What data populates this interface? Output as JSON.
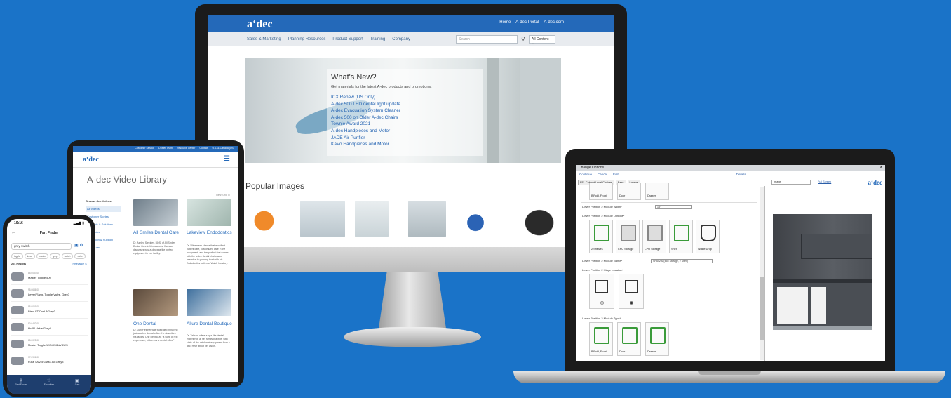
{
  "desktop": {
    "logo": "a‘dec",
    "top_links": [
      "Home",
      "A-dec Portal",
      "A-dec.com"
    ],
    "nav": [
      "Sales & Marketing",
      "Planning Resources",
      "Product Support",
      "Training",
      "Company"
    ],
    "search_placeholder": "Search",
    "search_scope": "All Content ⌄",
    "hero": {
      "title": "What's New?",
      "subtitle": "Get materials for the latest A-dec products and promotions.",
      "links": [
        "ICX Renew (US Only)",
        "A-dec 500 LED dental light update",
        "A-dec Evacuation System Cleaner",
        "A-dec 500 on Older A-dec Chairs",
        "Townie Award 2021",
        "A-dec Handpieces and Motor",
        "JADE Air Purifier",
        "KaVo Handpieces and Motor"
      ]
    },
    "popular_title": "Popular Images"
  },
  "tablet": {
    "top_links": [
      "Customer Service",
      "Dealer Team",
      "Resource Center",
      "Contact",
      "U.S. & Canada (US)"
    ],
    "logo": "a‘dec",
    "title": "A-dec Video Library",
    "view": "View: Grid ☰",
    "sidebar_heading": "Browse dec Videos",
    "sidebar": [
      "All Videos",
      "Customer Stories",
      "Products & Solutions",
      "Built a dec",
      "Education & Support",
      "Why a-dec"
    ],
    "cards": [
      {
        "title": "All Smiles Dental Care",
        "text": "Dr. Ashley Steckley, DDS, of All Smiles Dental Care in Minneapolis, Kansas, discusses why a-dec was the perfect equipment for her facility."
      },
      {
        "title": "Lakeview Endodontics",
        "text": "Dr. Wisemiere shares that excellent patient care, customized care in the equipment, and the perfect that comes with the a-dec dental chairs was essential to growing trust with his Endodontics patients. Watch his story."
      },
      {
        "title": "One Dental",
        "text": "Dr. Dan Fletcher was frustrated in having just another dental office. He describes his facility, One Dental, as \"a work of real experience, hidden as a dental office\""
      },
      {
        "title": "Allure Dental Boutique",
        "text": "Dr. Tahrani offers a spa-like dental experience at her family practice, with state-of-the-art dental equipment from A-dec. Hear about her vision."
      }
    ]
  },
  "phone": {
    "time": "10:16",
    "signal": "▂▄▆ ▮",
    "header": "Part Finder",
    "search_value": "grey switch",
    "chips": [
      "toggle",
      "lever",
      "master",
      "grey",
      "switch",
      "valve"
    ],
    "results": "204 Results",
    "relevance": "Relevance ⇅",
    "items": [
      {
        "code": "85.0037.00",
        "name": "Master Toggle,500"
      },
      {
        "code": "95.0646.00",
        "name": "Lever/Flame,Toggle Valve, Grey3"
      },
      {
        "code": "95.0001.00",
        "name": "Bleo, FT.Cntrl.AGrey3"
      },
      {
        "code": "90.0432.00",
        "name": "Hc0R Valve,Grey3"
      },
      {
        "code": "85.0025.00",
        "name": "Master Toggle W/DOSIDA/SWS"
      },
      {
        "code": "77.0901.00",
        "name": "Fuse 4A 2.5 Glass Ad.Grey3"
      }
    ],
    "tabs": [
      "Part Finder",
      "Favorites",
      "Cart"
    ]
  },
  "laptop": {
    "window_title": "Change Options",
    "toolbar": [
      "Continue",
      "Cancel",
      "Edit",
      "Details"
    ],
    "tabs": [
      "EFL Cabinet Level Choices",
      "Base",
      "Lowers"
    ],
    "image_select": "Image",
    "image_link": "Full Screen",
    "logo": "a‘dec",
    "labels": {
      "width": "Lower Position 2 Module Width*",
      "width_value": "18\"",
      "options": "Lower Position 2 Module Options*",
      "name": "Lower Position 2 Module Name*",
      "name_value": "SR5420L (Box Storage, 2 Shelf)",
      "hinge": "Lower Position 2 Hinge Location*",
      "type": "Lower Position 3 Module Type*"
    },
    "top_options": [
      "BiFold, Front",
      "Door",
      "Drawer"
    ],
    "module_options": [
      "2 Shelves",
      "CPU Storage",
      "CPU Storage",
      "Shelf",
      "Waste Drop"
    ],
    "type_options": [
      "BiFold, Front",
      "Door",
      "Drawer"
    ]
  }
}
